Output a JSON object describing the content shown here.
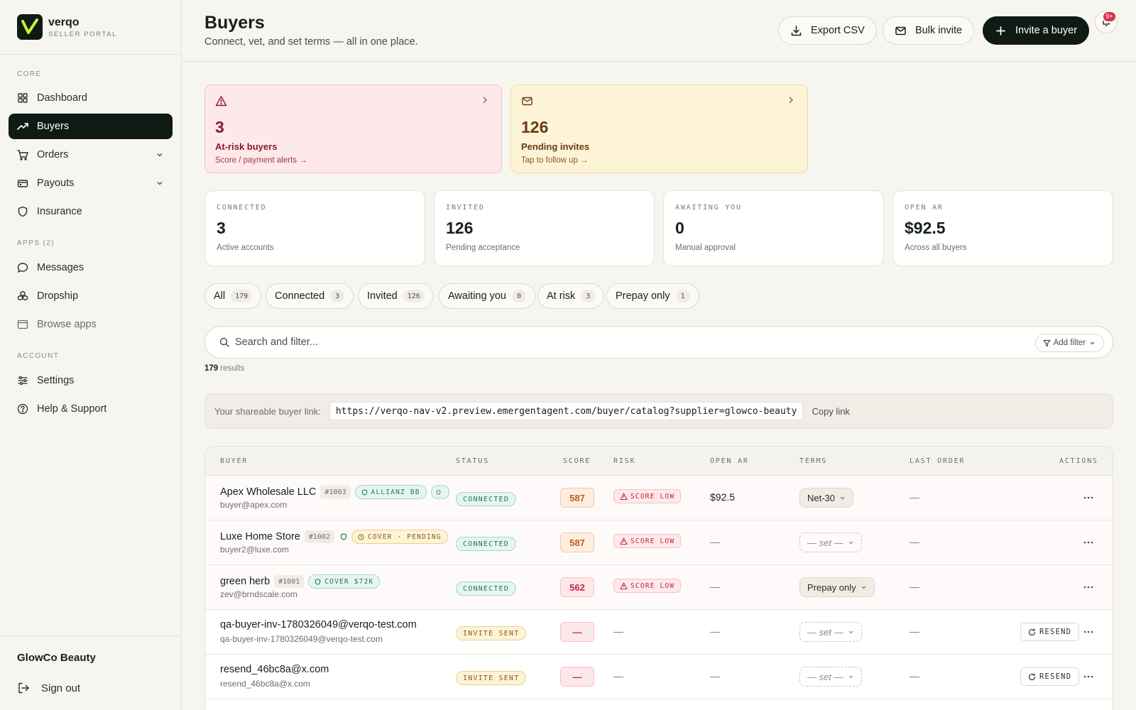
{
  "brand": {
    "name": "verqo",
    "subtitle": "SELLER PORTAL"
  },
  "sidebar": {
    "sections": {
      "core": "CORE",
      "apps": "APPS (2)",
      "account": "ACCOUNT"
    },
    "items": [
      {
        "label": "Dashboard",
        "icon": "grid-icon"
      },
      {
        "label": "Buyers",
        "icon": "trend-icon",
        "active": true
      },
      {
        "label": "Orders",
        "icon": "cart-icon"
      },
      {
        "label": "Payouts",
        "icon": "wallet-icon"
      },
      {
        "label": "Insurance",
        "icon": "shield-icon"
      },
      {
        "label": "Messages",
        "icon": "chat-icon"
      },
      {
        "label": "Dropship",
        "icon": "boxes-icon"
      },
      {
        "label": "Browse apps",
        "icon": "browser-icon"
      },
      {
        "label": "Settings",
        "icon": "sliders-icon"
      },
      {
        "label": "Help & Support",
        "icon": "help-icon"
      }
    ],
    "org": "GlowCo Beauty",
    "signout": "Sign out"
  },
  "header": {
    "title": "Buyers",
    "subtitle": "Connect, vet, and set terms — all in one place.",
    "export": "Export CSV",
    "bulk": "Bulk invite",
    "invite": "Invite a buyer",
    "badge": "9+"
  },
  "alerts": {
    "risk": {
      "count": "3",
      "title": "At-risk buyers",
      "link": "Score / payment alerts →"
    },
    "pending": {
      "count": "126",
      "title": "Pending invites",
      "link": "Tap to follow up →"
    }
  },
  "stats": [
    {
      "label": "CONNECTED",
      "value": "3",
      "sub": "Active accounts"
    },
    {
      "label": "INVITED",
      "value": "126",
      "sub": "Pending acceptance"
    },
    {
      "label": "AWAITING YOU",
      "value": "0",
      "sub": "Manual approval"
    },
    {
      "label": "OPEN AR",
      "value": "$92.5",
      "sub": "Across all buyers"
    }
  ],
  "filters": [
    {
      "label": "All",
      "count": "179"
    },
    {
      "label": "Connected",
      "count": "3"
    },
    {
      "label": "Invited",
      "count": "126"
    },
    {
      "label": "Awaiting you",
      "count": "0"
    },
    {
      "label": "At risk",
      "count": "3"
    },
    {
      "label": "Prepay only",
      "count": "1"
    }
  ],
  "search": {
    "placeholder": "Search and filter...",
    "add_filter": "Add filter"
  },
  "results": {
    "count": "179",
    "label": "results"
  },
  "share": {
    "label": "Your shareable buyer link:",
    "url": "https://verqo-nav-v2.preview.emergentagent.com/buyer/catalog?supplier=glowco-beauty",
    "copy": "Copy link"
  },
  "table": {
    "headers": [
      "BUYER",
      "STATUS",
      "SCORE",
      "RISK",
      "OPEN AR",
      "TERMS",
      "LAST ORDER",
      "ACTIONS"
    ],
    "rows": [
      {
        "name": "Apex Wholesale LLC",
        "id": "#1003",
        "tag1": "ALLIANZ BB",
        "email": "buyer@apex.com",
        "status": "CONNECTED",
        "score": "587",
        "risk": "SCORE LOW",
        "open_ar": "$92.5",
        "terms": "Net-30",
        "last": "—"
      },
      {
        "name": "Luxe Home Store",
        "id": "#1002",
        "tag1": "COVER · PENDING",
        "email": "buyer2@luxe.com",
        "status": "CONNECTED",
        "score": "587",
        "risk": "SCORE LOW",
        "open_ar": "—",
        "terms": "— set —",
        "last": "—"
      },
      {
        "name": "green herb",
        "id": "#1001",
        "tag1": "COVER $72K",
        "email": "zev@brndscale.com",
        "status": "CONNECTED",
        "score": "562",
        "risk": "SCORE LOW",
        "open_ar": "—",
        "terms": "Prepay only",
        "last": "—"
      },
      {
        "name": "qa-buyer-inv-1780326049@verqo-test.com",
        "email": "qa-buyer-inv-1780326049@verqo-test.com",
        "status": "INVITE SENT",
        "score": "—",
        "risk": "—",
        "open_ar": "—",
        "terms": "— set —",
        "last": "—",
        "action": "RESEND"
      },
      {
        "name": "resend_46bc8a@x.com",
        "email": "resend_46bc8a@x.com",
        "status": "INVITE SENT",
        "score": "—",
        "risk": "—",
        "open_ar": "—",
        "terms": "— set —",
        "last": "—",
        "action": "RESEND"
      }
    ]
  }
}
